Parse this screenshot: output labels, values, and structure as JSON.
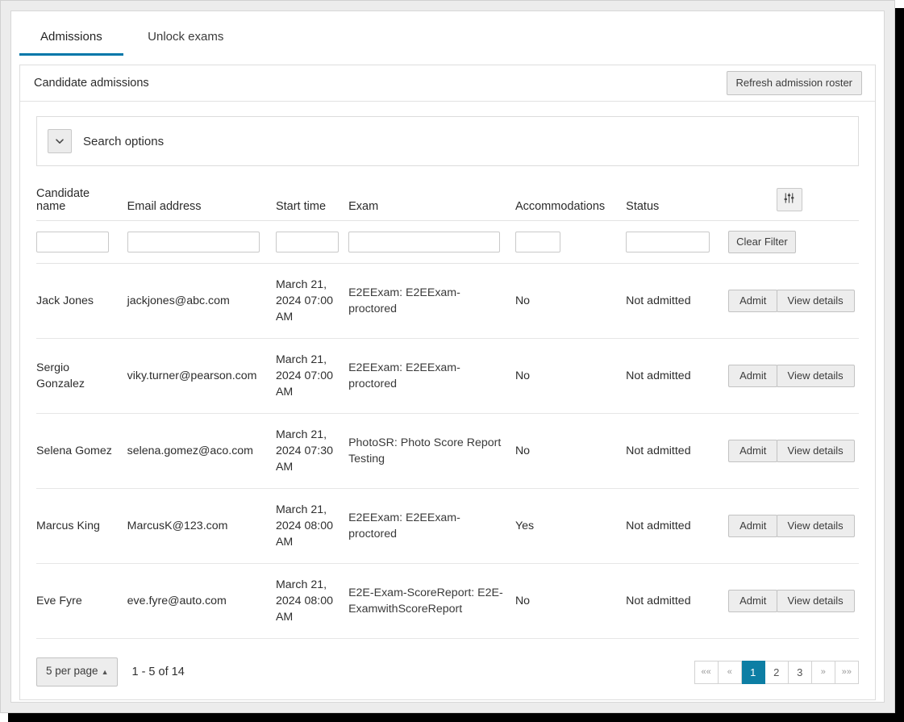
{
  "tabs": [
    {
      "label": "Admissions",
      "active": true
    },
    {
      "label": "Unlock exams",
      "active": false
    }
  ],
  "card": {
    "title": "Candidate admissions",
    "refresh_label": "Refresh admission roster"
  },
  "search": {
    "label": "Search options",
    "chevron_icon": "chevron-down-icon"
  },
  "table": {
    "settings_icon": "sliders-icon",
    "headers": {
      "name": "Candidate name",
      "email": "Email address",
      "start_time": "Start time",
      "exam": "Exam",
      "accommodations": "Accommodations",
      "status": "Status"
    },
    "filters": {
      "name": "",
      "email": "",
      "start_time": "",
      "exam": "",
      "accommodations": "",
      "status": "",
      "clear_label": "Clear Filter"
    },
    "actions": {
      "admit_label": "Admit",
      "view_label": "View details"
    },
    "rows": [
      {
        "name": "Jack Jones",
        "email": "jackjones@abc.com",
        "start_time": "March 21, 2024 07:00 AM",
        "exam": "E2EExam: E2EExam-proctored",
        "accommodations": "No",
        "status": "Not admitted"
      },
      {
        "name": "Sergio Gonzalez",
        "email": "viky.turner@pearson.com",
        "start_time": "March 21, 2024 07:00 AM",
        "exam": "E2EExam: E2EExam-proctored",
        "accommodations": "No",
        "status": "Not admitted"
      },
      {
        "name": "Selena Gomez",
        "email": "selena.gomez@aco.com",
        "start_time": "March 21, 2024 07:30 AM",
        "exam": "PhotoSR: Photo Score Report Testing",
        "accommodations": "No",
        "status": "Not admitted"
      },
      {
        "name": "Marcus King",
        "email": "MarcusK@123.com",
        "start_time": "March 21, 2024 08:00 AM",
        "exam": "E2EExam: E2EExam-proctored",
        "accommodations": "Yes",
        "status": "Not admitted"
      },
      {
        "name": "Eve Fyre",
        "email": "eve.fyre@auto.com",
        "start_time": "March 21, 2024 08:00 AM",
        "exam": "E2E-Exam-ScoreReport: E2E-ExamwithScoreReport",
        "accommodations": "No",
        "status": "Not admitted"
      }
    ]
  },
  "footer": {
    "per_page_label": "5 per page",
    "range_text": "1 - 5 of 14",
    "pages": [
      {
        "label": "««",
        "active": false,
        "kind": "arrow"
      },
      {
        "label": "«",
        "active": false,
        "kind": "arrow"
      },
      {
        "label": "1",
        "active": true,
        "kind": "num"
      },
      {
        "label": "2",
        "active": false,
        "kind": "num"
      },
      {
        "label": "3",
        "active": false,
        "kind": "num"
      },
      {
        "label": "»",
        "active": false,
        "kind": "arrow"
      },
      {
        "label": "»»",
        "active": false,
        "kind": "arrow"
      }
    ]
  },
  "colors": {
    "accent": "#0077a9",
    "pager_active": "#0d7ea4"
  }
}
